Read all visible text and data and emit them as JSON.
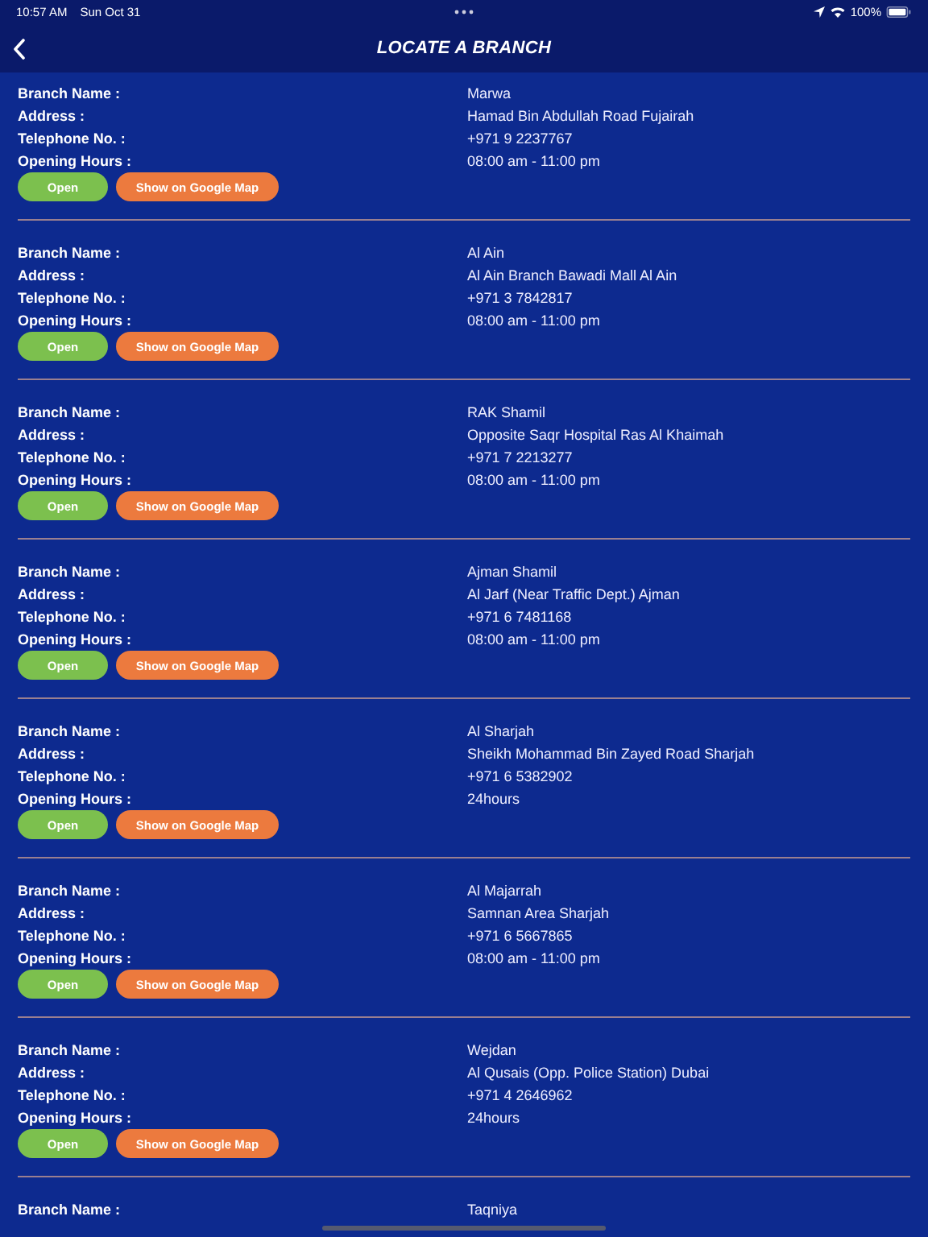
{
  "status_bar": {
    "time": "10:57 AM",
    "date": "Sun Oct 31",
    "battery": "100%"
  },
  "nav": {
    "title": "LOCATE A BRANCH"
  },
  "branches": [
    {
      "fields": [
        {
          "label": "Branch Name :",
          "value": "Marwa"
        },
        {
          "label": "Address :",
          "value": "Hamad Bin Abdullah Road Fujairah"
        },
        {
          "label": "Telephone No. :",
          "value": "+971 9 2237767"
        },
        {
          "label": "Opening Hours :",
          "value": "08:00 am - 11:00 pm"
        }
      ],
      "open_button": "Open",
      "map_button": "Show on Google Map"
    },
    {
      "fields": [
        {
          "label": "Branch Name :",
          "value": "Al Ain"
        },
        {
          "label": "Address :",
          "value": "Al Ain Branch Bawadi Mall Al Ain"
        },
        {
          "label": "Telephone No. :",
          "value": "+971 3 7842817"
        },
        {
          "label": "Opening Hours :",
          "value": "08:00 am - 11:00 pm"
        }
      ],
      "open_button": "Open",
      "map_button": "Show on Google Map"
    },
    {
      "fields": [
        {
          "label": "Branch Name :",
          "value": "RAK Shamil"
        },
        {
          "label": "Address :",
          "value": "Opposite Saqr Hospital Ras Al Khaimah"
        },
        {
          "label": "Telephone No. :",
          "value": "+971 7 2213277"
        },
        {
          "label": "Opening Hours :",
          "value": "08:00 am - 11:00 pm"
        }
      ],
      "open_button": "Open",
      "map_button": "Show on Google Map"
    },
    {
      "fields": [
        {
          "label": "Branch Name :",
          "value": "Ajman Shamil"
        },
        {
          "label": "Address :",
          "value": "Al Jarf (Near Traffic Dept.) Ajman"
        },
        {
          "label": "Telephone No. :",
          "value": "+971 6 7481168"
        },
        {
          "label": "Opening Hours :",
          "value": "08:00 am - 11:00 pm"
        }
      ],
      "open_button": "Open",
      "map_button": "Show on Google Map"
    },
    {
      "fields": [
        {
          "label": "Branch Name :",
          "value": "Al Sharjah"
        },
        {
          "label": "Address :",
          "value": "Sheikh Mohammad Bin Zayed Road Sharjah"
        },
        {
          "label": "Telephone No. :",
          "value": "+971 6 5382902"
        },
        {
          "label": "Opening Hours :",
          "value": "24hours"
        }
      ],
      "open_button": "Open",
      "map_button": "Show on Google Map"
    },
    {
      "fields": [
        {
          "label": "Branch Name :",
          "value": "Al Majarrah"
        },
        {
          "label": "Address :",
          "value": "Samnan Area Sharjah"
        },
        {
          "label": "Telephone No. :",
          "value": "+971 6 5667865"
        },
        {
          "label": "Opening Hours :",
          "value": "08:00 am - 11:00 pm"
        }
      ],
      "open_button": "Open",
      "map_button": "Show on Google Map"
    },
    {
      "fields": [
        {
          "label": "Branch Name :",
          "value": "Wejdan"
        },
        {
          "label": "Address :",
          "value": "Al Qusais (Opp. Police Station) Dubai"
        },
        {
          "label": "Telephone No. :",
          "value": "+971 4 2646962"
        },
        {
          "label": "Opening Hours :",
          "value": "24hours"
        }
      ],
      "open_button": "Open",
      "map_button": "Show on Google Map"
    },
    {
      "fields": [
        {
          "label": "Branch Name :",
          "value": "Taqniya"
        }
      ]
    }
  ]
}
